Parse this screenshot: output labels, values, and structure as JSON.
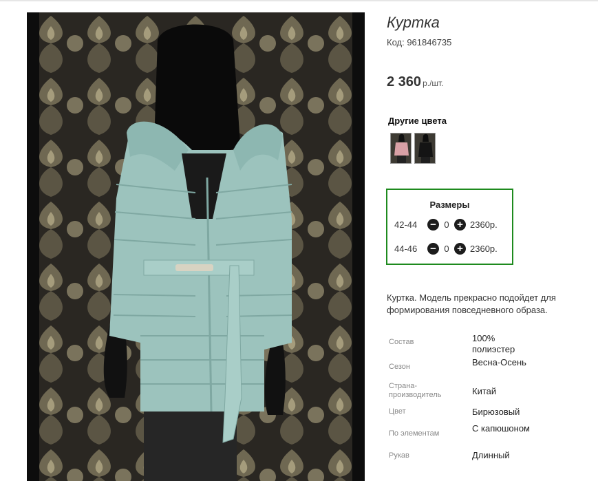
{
  "product": {
    "title": "Куртка",
    "code": "Код: 961846735",
    "price_value": "2 360",
    "price_unit": "р./шт."
  },
  "other_colors": {
    "title": "Другие цвета",
    "swatches": [
      "pink-jacket-thumbnail",
      "black-jacket-thumbnail"
    ]
  },
  "sizes": {
    "title": "Размеры",
    "rows": [
      {
        "label": "42-44",
        "qty": "0",
        "price": "2360р."
      },
      {
        "label": "44-46",
        "qty": "0",
        "price": "2360р."
      }
    ]
  },
  "description": "Куртка. Модель прекрасно подойдет для формирования повседневного образа.",
  "specs": [
    {
      "key": "Состав",
      "value": "100% полиэстер"
    },
    {
      "key": "Сезон",
      "value": "Весна-Осень"
    },
    {
      "key": "Страна-производитель",
      "value": "Китай"
    },
    {
      "key": "Цвет",
      "value": "Бирюзовый"
    },
    {
      "key": "По элементам",
      "value": "С капюшоном"
    },
    {
      "key": "Рукав",
      "value": "Длинный"
    }
  ],
  "icons": {
    "minus": "minus-circle-icon",
    "plus": "plus-circle-icon"
  },
  "colors": {
    "accent_border": "#1e8a1e",
    "jacket": "#9cc3bd"
  }
}
